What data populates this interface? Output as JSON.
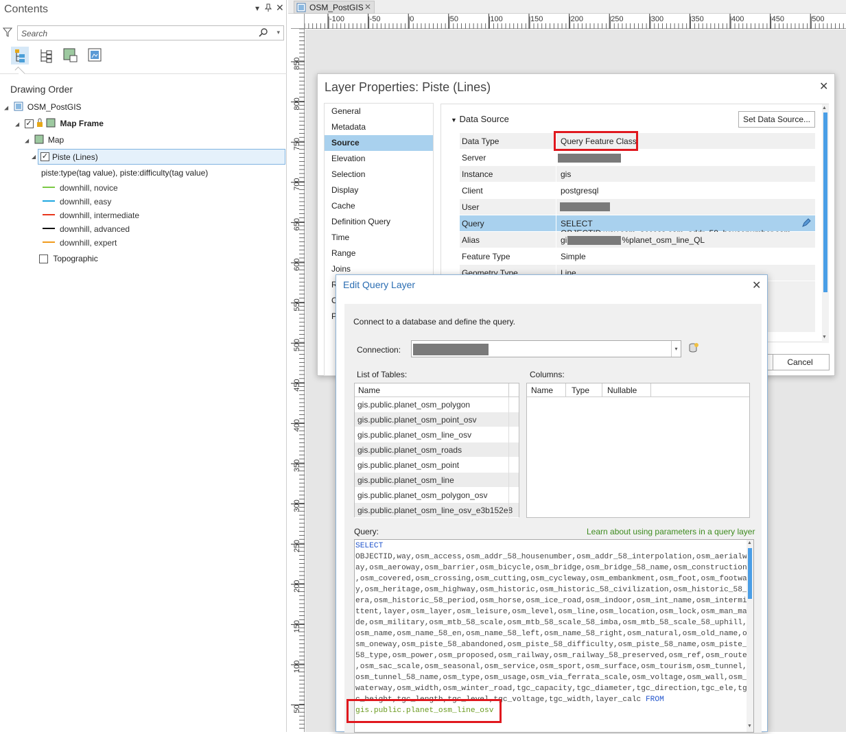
{
  "contents_pane": {
    "title": "Contents",
    "search_placeholder": "Search",
    "section_title": "Drawing Order",
    "tree": {
      "map_name": "OSM_PostGIS",
      "map_frame": "Map Frame",
      "map": "Map",
      "layer": "Piste (Lines)",
      "legend_header": "piste:type(tag value), piste:difficulty(tag value)",
      "legend_items": [
        {
          "label": "downhill, novice",
          "color": "#7ac943"
        },
        {
          "label": "downhill, easy",
          "color": "#1ea7e0"
        },
        {
          "label": "downhill, intermediate",
          "color": "#e8361c"
        },
        {
          "label": "downhill, advanced",
          "color": "#111111"
        },
        {
          "label": "downhill, expert",
          "color": "#f09a1c"
        }
      ],
      "basemap": "Topographic"
    }
  },
  "map_tab": {
    "label": "OSM_PostGIS"
  },
  "ruler": {
    "top_labels": [
      "-100",
      "-50",
      "0",
      "50",
      "100",
      "150",
      "200",
      "250",
      "300",
      "350",
      "400",
      "450",
      "500"
    ],
    "left_labels": [
      "850",
      "800",
      "750",
      "700",
      "650",
      "600",
      "550",
      "500",
      "450",
      "400",
      "350",
      "300",
      "250",
      "200",
      "150",
      "100",
      "50"
    ]
  },
  "layer_properties": {
    "title": "Layer Properties: Piste (Lines)",
    "nav": [
      "General",
      "Metadata",
      "Source",
      "Elevation",
      "Selection",
      "Display",
      "Cache",
      "Definition Query",
      "Time",
      "Range",
      "Joins",
      "R",
      "C",
      "P"
    ],
    "selected_nav": "Source",
    "section": "Data Source",
    "set_source_button": "Set Data Source...",
    "rows": [
      {
        "key": "Data Type",
        "value": "Query Feature Class"
      },
      {
        "key": "Server",
        "value": ""
      },
      {
        "key": "Instance",
        "value": "gis"
      },
      {
        "key": "Client",
        "value": "postgresql"
      },
      {
        "key": "User",
        "value": ""
      },
      {
        "key": "Query",
        "value": "SELECT OBJECTID,way,osm_access,osm_addr_58_housenumber,osm"
      },
      {
        "key": "Alias",
        "value_prefix": "gi",
        "value_suffix": "%planet_osm_line_QL"
      },
      {
        "key": "Feature Type",
        "value": "Simple"
      },
      {
        "key": "Geometry Type",
        "value": "Line"
      }
    ],
    "cancel_button": "Cancel"
  },
  "edit_query_layer": {
    "title": "Edit Query Layer",
    "intro": "Connect to a database and define the query.",
    "connection_label": "Connection:",
    "tables_label": "List of Tables:",
    "columns_label": "Columns:",
    "tables_header": "Name",
    "tables": [
      "gis.public.planet_osm_polygon",
      "gis.public.planet_osm_point_osv",
      "gis.public.planet_osm_line_osv",
      "gis.public.planet_osm_roads",
      "gis.public.planet_osm_point",
      "gis.public.planet_osm_line",
      "gis.public.planet_osm_polygon_osv",
      "gis.public.planet_osm_line_osv_e3b152e8"
    ],
    "columns_headers": [
      "Name",
      "Type",
      "Nullable"
    ],
    "query_label": "Query:",
    "help_link": "Learn about using parameters in a query layer",
    "query_keyword_select": "SELECT",
    "query_lines": [
      "OBJECTID,way,osm_access,osm_addr_58_housenumber,osm_addr_58_interpolation,osm_aerialw",
      "ay,osm_aeroway,osm_barrier,osm_bicycle,osm_bridge,osm_bridge_58_name,osm_construction",
      ",osm_covered,osm_crossing,osm_cutting,osm_cycleway,osm_embankment,osm_foot,osm_footwa",
      "y,osm_heritage,osm_highway,osm_historic,osm_historic_58_civilization,osm_historic_58_",
      "era,osm_historic_58_period,osm_horse,osm_ice_road,osm_indoor,osm_int_name,osm_intermi",
      "ttent,layer,osm_layer,osm_leisure,osm_level,osm_line,osm_location,osm_lock,osm_man_ma",
      "de,osm_military,osm_mtb_58_scale,osm_mtb_58_scale_58_imba,osm_mtb_58_scale_58_uphill,",
      "osm_name,osm_name_58_en,osm_name_58_left,osm_name_58_right,osm_natural,osm_old_name,o",
      "sm_oneway,osm_piste_58_abandoned,osm_piste_58_difficulty,osm_piste_58_name,osm_piste_",
      "58_type,osm_power,osm_proposed,osm_railway,osm_railway_58_preserved,osm_ref,osm_route",
      ",osm_sac_scale,osm_seasonal,osm_service,osm_sport,osm_surface,osm_tourism,osm_tunnel,",
      "osm_tunnel_58_name,osm_type,osm_usage,osm_via_ferrata_scale,osm_voltage,osm_wall,osm_",
      "waterway,osm_width,osm_winter_road,tgc_capacity,tgc_diameter,tgc_direction,tgc_ele,tg",
      "c_height,tgc_length,tgc_level,tgc_voltage,tgc_width,layer_calc"
    ],
    "query_keyword_from": "FROM",
    "query_table": "gis.public.planet_osm_line_osv"
  }
}
